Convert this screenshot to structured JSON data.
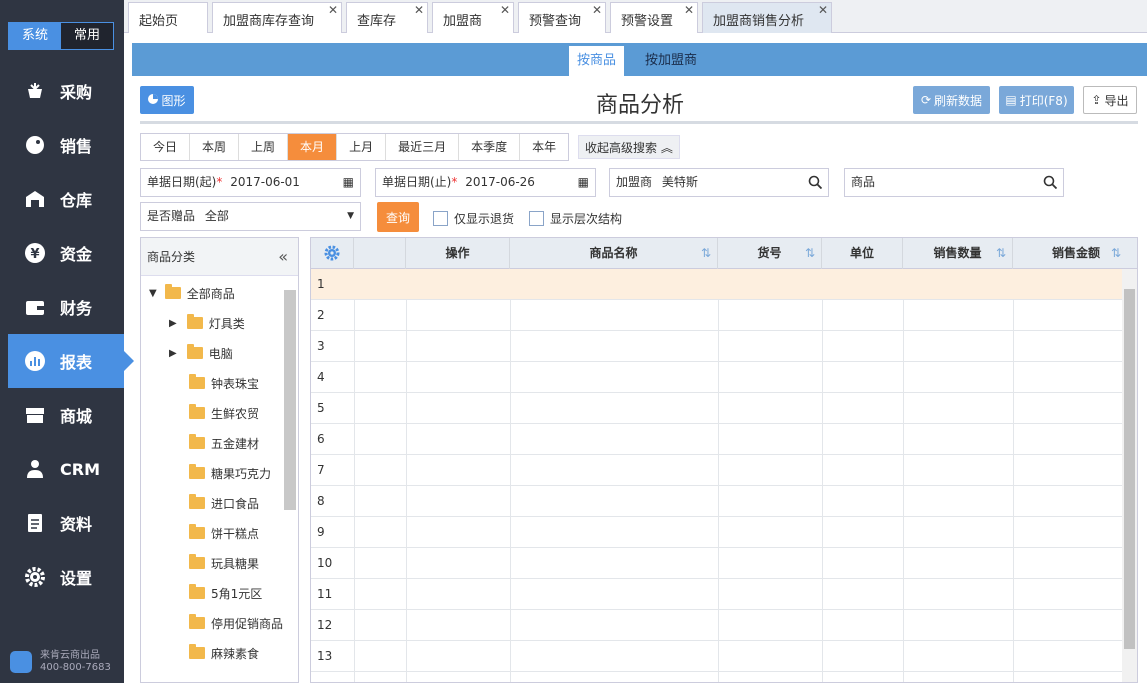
{
  "sidebar": {
    "toggle": {
      "active": "系统",
      "inactive": "常用"
    },
    "items": [
      {
        "label": "采购",
        "icon": "basket-icon"
      },
      {
        "label": "销售",
        "icon": "tag-icon"
      },
      {
        "label": "仓库",
        "icon": "warehouse-icon"
      },
      {
        "label": "资金",
        "icon": "yen-icon"
      },
      {
        "label": "财务",
        "icon": "wallet-icon"
      },
      {
        "label": "报表",
        "icon": "chart-icon",
        "active": true
      },
      {
        "label": "商城",
        "icon": "store-icon"
      },
      {
        "label": "CRM",
        "icon": "person-icon"
      },
      {
        "label": "资料",
        "icon": "document-icon"
      },
      {
        "label": "设置",
        "icon": "gear-icon"
      }
    ],
    "brand": {
      "line1": "来肯云商出品",
      "line2": "400-800-7683"
    }
  },
  "tabs": [
    "起始页",
    "加盟商库存查询",
    "查库存",
    "加盟商",
    "预警查询",
    "预警设置",
    "加盟商销售分析"
  ],
  "subtabs": [
    "按商品",
    "按加盟商"
  ],
  "toolbar": {
    "chart_btn": "图形",
    "title": "商品分析",
    "refresh": "刷新数据",
    "print": "打印(F8)",
    "export": "导出"
  },
  "periods": [
    "今日",
    "本周",
    "上周",
    "本月",
    "上月",
    "最近三月",
    "本季度",
    "本年"
  ],
  "adv_search": "收起高级搜索",
  "filters": {
    "date_start_label": "单据日期(起)",
    "date_start": "2017-06-01",
    "date_end_label": "单据日期(止)",
    "date_end": "2017-06-26",
    "franchisee_label": "加盟商",
    "franchisee": "美特斯",
    "product_label": "商品",
    "gift_label": "是否赠品",
    "gift_value": "全部",
    "query": "查询",
    "only_returns": "仅显示退货",
    "show_hierarchy": "显示层次结构"
  },
  "category": {
    "header": "商品分类",
    "root": "全部商品",
    "items": [
      "灯具类",
      "电脑",
      "钟表珠宝",
      "生鲜农贸",
      "五金建材",
      "糖果巧克力",
      "进口食品",
      "饼干糕点",
      "玩具糖果",
      "5角1元区",
      "停用促销商品",
      "麻辣素食"
    ]
  },
  "grid": {
    "columns": [
      "操作",
      "商品名称",
      "货号",
      "单位",
      "销售数量",
      "销售金额"
    ],
    "rows": [
      "1",
      "2",
      "3",
      "4",
      "5",
      "6",
      "7",
      "8",
      "9",
      "10",
      "11",
      "12",
      "13"
    ]
  },
  "colors": {
    "accent": "#4a90e2",
    "sidebar": "#2f3542",
    "active_period": "#f58d3c"
  }
}
